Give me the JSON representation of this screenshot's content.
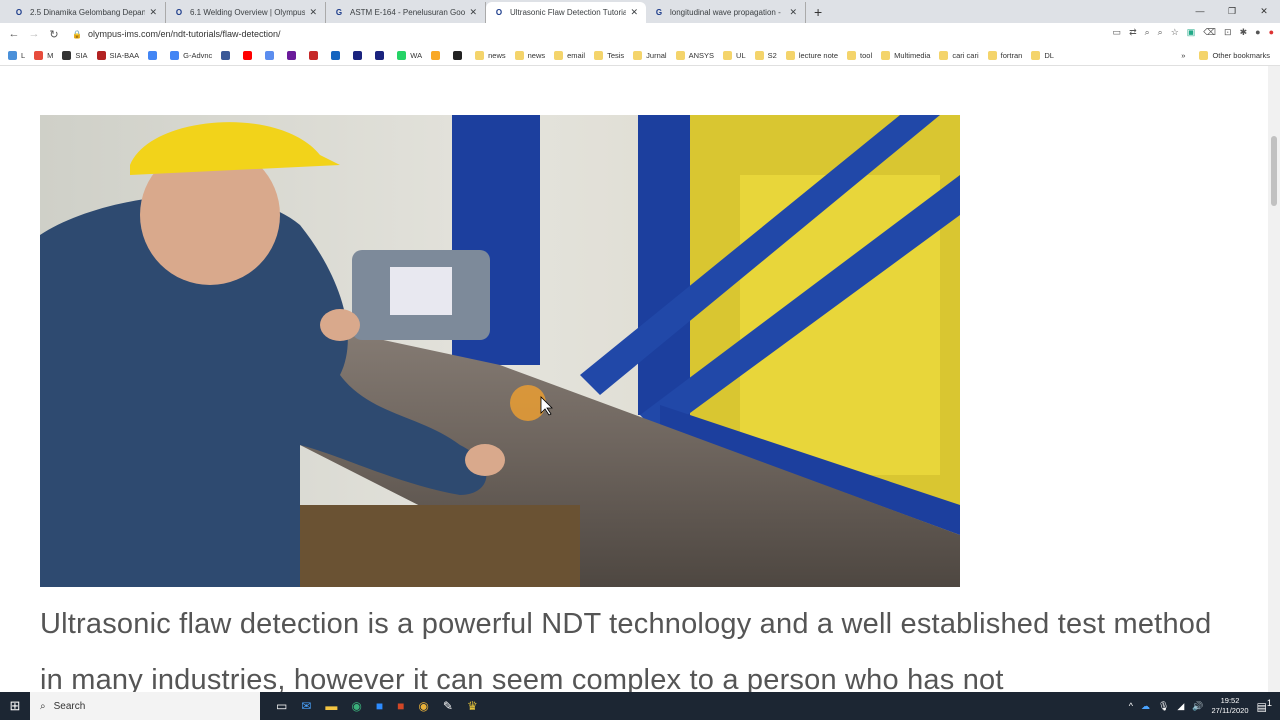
{
  "browser": {
    "tabs": [
      {
        "label": "2.5 Dinamika Gelombang Depan",
        "favicon": "O",
        "active": false
      },
      {
        "label": "6.1 Welding Overview | Olympus",
        "favicon": "O",
        "active": false
      },
      {
        "label": "ASTM E-164 - Penelusuran Goog",
        "favicon": "G",
        "active": false
      },
      {
        "label": "Ultrasonic Flaw Detection Tutoria",
        "favicon": "O",
        "active": true
      },
      {
        "label": "longitudinal wave propagation -",
        "favicon": "G",
        "active": false
      }
    ],
    "new_tab": "+",
    "url": "olympus-ims.com/en/ndt-tutorials/flaw-detection/",
    "bookmarks": [
      {
        "label": "L",
        "color": "#4a90d9"
      },
      {
        "label": "M",
        "color": "#e74c3c"
      },
      {
        "label": "SIA",
        "color": "#333333"
      },
      {
        "label": "SIA-BAA",
        "color": "#b22222"
      },
      {
        "label": "",
        "color": "#4285f4"
      },
      {
        "label": "G-Advnc",
        "color": "#4285f4"
      },
      {
        "label": "",
        "color": "#3b5998"
      },
      {
        "label": "",
        "color": "#ff0000"
      },
      {
        "label": "",
        "color": "#5b8def"
      },
      {
        "label": "",
        "color": "#6a1b9a"
      },
      {
        "label": "",
        "color": "#c62828"
      },
      {
        "label": "",
        "color": "#1565c0"
      },
      {
        "label": "",
        "color": "#1a237e"
      },
      {
        "label": "",
        "color": "#1a237e"
      },
      {
        "label": "WA",
        "color": "#25d366"
      },
      {
        "label": "",
        "color": "#f9a825"
      },
      {
        "label": "",
        "color": "#222222"
      },
      {
        "label": "news",
        "folder": true
      },
      {
        "label": "news",
        "folder": true
      },
      {
        "label": "email",
        "folder": true
      },
      {
        "label": "Tesis",
        "folder": true
      },
      {
        "label": "Jurnal",
        "folder": true
      },
      {
        "label": "ANSYS",
        "folder": true
      },
      {
        "label": "UL",
        "folder": true
      },
      {
        "label": "S2",
        "folder": true
      },
      {
        "label": "lecture note",
        "folder": true
      },
      {
        "label": "tool",
        "folder": true
      },
      {
        "label": "Multimedia",
        "folder": true
      },
      {
        "label": "cari cari",
        "folder": true
      },
      {
        "label": "fortran",
        "folder": true
      },
      {
        "label": "DL",
        "folder": true
      }
    ],
    "more": "»",
    "other_bookmarks": "Other bookmarks"
  },
  "page": {
    "body_text": "Ultrasonic flaw detection is a powerful NDT technology and a well established test method in many industries, however it can seem complex to a person who has not"
  },
  "taskbar": {
    "search": "Search",
    "time": "19:52",
    "date": "27/11/2020",
    "notifications": "1"
  }
}
